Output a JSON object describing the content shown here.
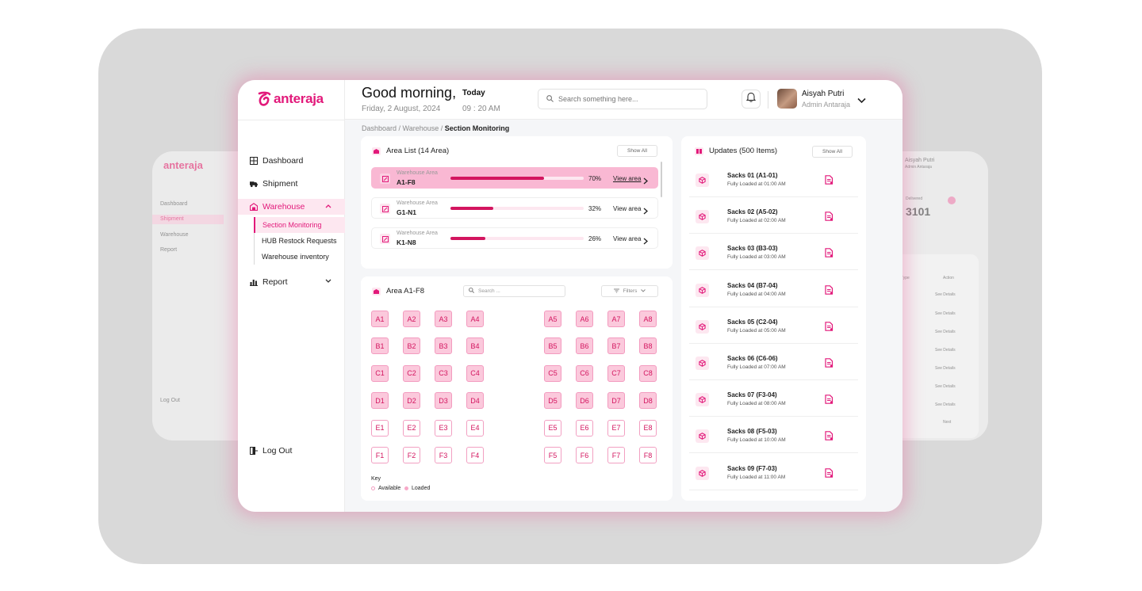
{
  "brand": {
    "name": "anteraja",
    "accent": "#e2197a",
    "accent_dark": "#d3155f",
    "tint": "#fde7f0"
  },
  "ghost_left": {
    "nav": [
      "Dashboard",
      "Shipment",
      "Warehouse",
      "Report"
    ],
    "logout": "Log Out"
  },
  "ghost_right": {
    "user": "Aisyah Putri",
    "role": "Admin Antaraja",
    "stat_label": "Delivered",
    "stat_value": "3101",
    "col_type": "Type",
    "col_action": "Action",
    "action_label": "See Details",
    "next_label": "Next"
  },
  "header": {
    "greeting": "Good morning,",
    "today_label": "Today",
    "date": "Friday, 2 August, 2024",
    "time": "09 : 20 AM",
    "search_placeholder": "Search something here...",
    "user_name": "Aisyah Putri",
    "user_role": "Admin Antaraja"
  },
  "sidebar": {
    "items": [
      {
        "label": "Dashboard",
        "icon": "grid-icon"
      },
      {
        "label": "Shipment",
        "icon": "truck-icon"
      },
      {
        "label": "Warehouse",
        "icon": "warehouse-icon",
        "active": true
      },
      {
        "label": "Report",
        "icon": "bar-chart-icon"
      }
    ],
    "warehouse_sub": [
      "Section Monitoring",
      "HUB Restock Requests",
      "Warehouse inventory"
    ],
    "logout": "Log Out"
  },
  "breadcrumb": {
    "path": "Dashboard / Warehouse / ",
    "current": "Section Monitoring"
  },
  "area_list": {
    "title": "Area List (14 Area)",
    "show_all": "Show All",
    "rows": [
      {
        "label": "Warehouse Area",
        "name": "A1-F8",
        "pct_text": "70%",
        "fraction": 0.7,
        "view": "View area",
        "selected": true
      },
      {
        "label": "Warehouse Area",
        "name": "G1-N1",
        "pct_text": "32%",
        "fraction": 0.32,
        "view": "View area",
        "selected": false
      },
      {
        "label": "Warehouse Area",
        "name": "K1-N8",
        "pct_text": "26%",
        "fraction": 0.26,
        "view": "View area",
        "selected": false
      }
    ]
  },
  "area_grid": {
    "title": "Area A1-F8",
    "search_placeholder": "Search ...",
    "filters_label": "Filters",
    "rows": [
      "A",
      "B",
      "C",
      "D",
      "E",
      "F"
    ],
    "cols": [
      1,
      2,
      3,
      4,
      5,
      6,
      7,
      8
    ],
    "available": [
      "E1",
      "E2",
      "E3",
      "E4",
      "E5",
      "E6",
      "E7",
      "E8",
      "F1",
      "F2",
      "F3",
      "F4",
      "F5",
      "F6",
      "F7",
      "F8"
    ],
    "key_title": "Key",
    "key_available": "Available",
    "key_loaded": "Loaded"
  },
  "updates": {
    "title": "Updates (500 Items)",
    "show_all": "Show All",
    "items": [
      {
        "title": "Sacks 01 (A1-01)",
        "status": "Fully Loaded at 01:00 AM"
      },
      {
        "title": "Sacks 02 (A5-02)",
        "status": "Fully Loaded at 02:00 AM"
      },
      {
        "title": "Sacks 03 (B3-03)",
        "status": "Fully Loaded at 03:00 AM"
      },
      {
        "title": "Sacks 04 (B7-04)",
        "status": "Fully Loaded at 04:00 AM"
      },
      {
        "title": "Sacks 05 (C2-04)",
        "status": "Fully Loaded at 05:00 AM"
      },
      {
        "title": "Sacks 06 (C6-06)",
        "status": "Fully Loaded at 07:00 AM"
      },
      {
        "title": "Sacks 07 (F3-04)",
        "status": "Fully Loaded at 08:00 AM"
      },
      {
        "title": "Sacks 08 (F5-03)",
        "status": "Fully Loaded at 10:00 AM"
      },
      {
        "title": "Sacks 09 (F7-03)",
        "status": "Fully Loaded at 11:00 AM"
      }
    ]
  }
}
